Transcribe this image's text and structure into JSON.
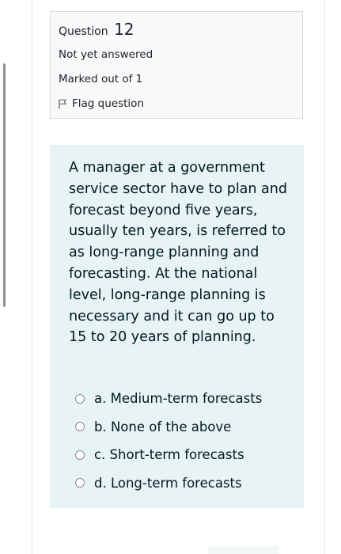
{
  "question_info": {
    "label": "Question",
    "number": "12",
    "state": "Not yet answered",
    "grade": "Marked out of 1",
    "flag_label": "Flag question"
  },
  "question": {
    "text": "A manager at a government service sector have to plan and forecast beyond five years, usually ten years, is referred to as long-range planning and forecasting. At the national level, long-range planning is necessary and it can go up to 15 to 20 years of planning."
  },
  "answers": [
    {
      "label": "a. Medium-term forecasts",
      "selected": false
    },
    {
      "label": "b. None of the above",
      "selected": false
    },
    {
      "label": "c. Short-term forecasts",
      "selected": false
    },
    {
      "label": "d. Long-term forecasts",
      "selected": false
    }
  ],
  "colors": {
    "info_background": "#f8f9fa",
    "question_background": "#e7f3f5",
    "text": "#001a1e"
  },
  "icons": {
    "flag": "flag-icon",
    "radio": "radio-icon"
  }
}
